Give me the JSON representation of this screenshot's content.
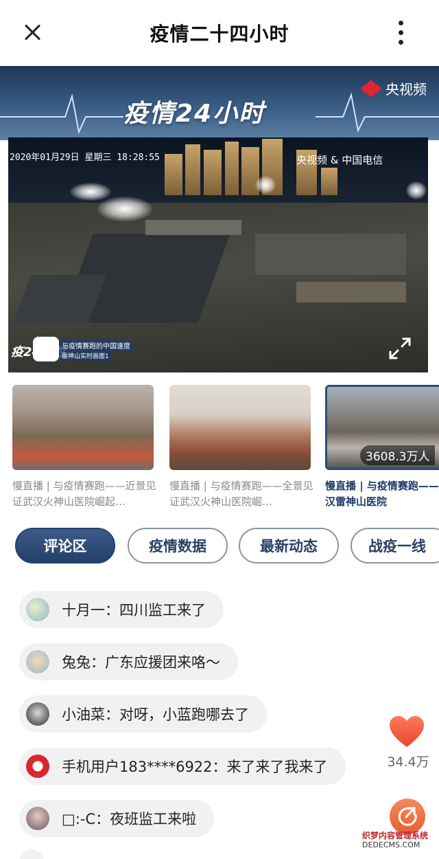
{
  "topbar": {
    "title": "疫情二十四小时",
    "close_icon": "close-icon",
    "more_icon": "more-vertical-icon"
  },
  "banner": {
    "title": "疫情24小时",
    "logo_text": "央视频"
  },
  "video": {
    "timestamp": "2020年01月29日 星期三 18:28:55",
    "brand": "央视频 & 中国电信",
    "overlay_logo": "疫24小时",
    "overlay_line1": "与疫情赛跑的中国速度",
    "overlay_line2": "雷神山实时画面1"
  },
  "thumbnails": [
    {
      "caption": "慢直播 | 与疫情赛跑——近景见证武汉火神山医院崛起…",
      "active": false
    },
    {
      "caption": "慢直播 | 与疫情赛跑——全景见证武汉火神山医院崛…",
      "active": false
    },
    {
      "caption": "慢直播 | 与疫情赛跑——直击武汉雷神山医院",
      "views": "3608.3万人",
      "active": true
    }
  ],
  "tabs": [
    {
      "label": "评论区",
      "active": true
    },
    {
      "label": "疫情数据",
      "active": false
    },
    {
      "label": "最新动态",
      "active": false
    },
    {
      "label": "战疫一线",
      "active": false
    }
  ],
  "comments": [
    {
      "text": "十月一：四川监工来了"
    },
    {
      "text": "兔兔：广东应援团来咯～"
    },
    {
      "text": "小油菜：对呀，小蓝跑哪去了"
    },
    {
      "text": "手机用户183****6922：来了来了我来了"
    },
    {
      "text": "□:-C：夜班监工来啦"
    }
  ],
  "floating": {
    "like_count": "34.4万",
    "like_icon": "heart-icon",
    "share_icon": "share-icon"
  },
  "watermark": {
    "line1": "织梦内容管理系统",
    "line2": "DEDECMS.COM"
  },
  "colors": {
    "accent": "#24406c",
    "like": "#ee4b3a",
    "share": "#e8653a"
  }
}
